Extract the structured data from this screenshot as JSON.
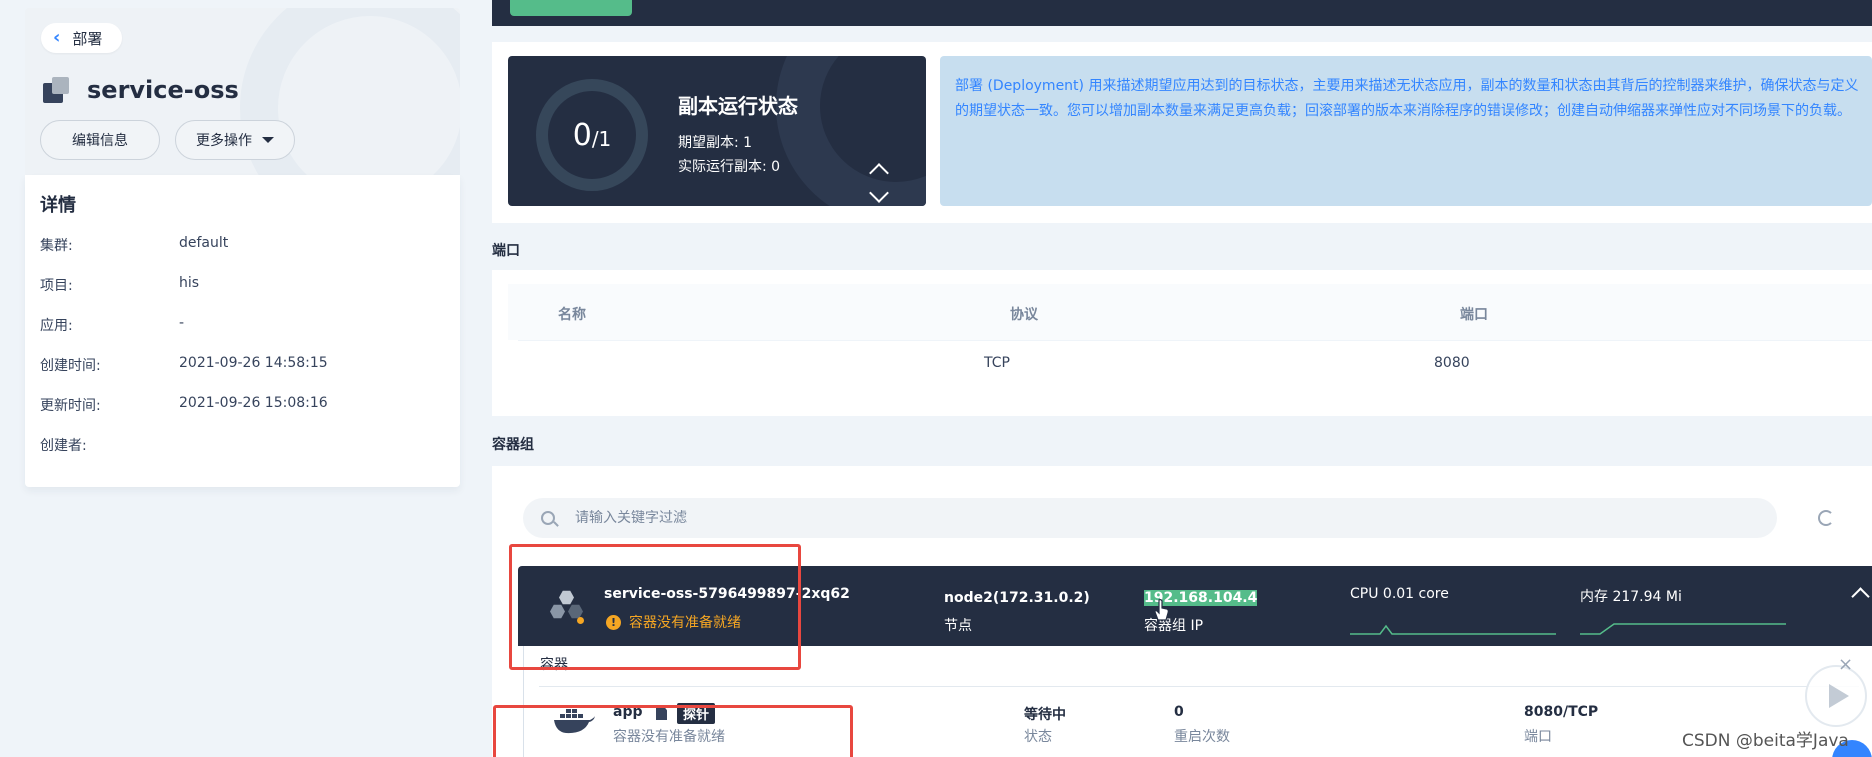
{
  "left": {
    "back_label": "部署",
    "service_name": "service-oss",
    "edit_button": "编辑信息",
    "more_button": "更多操作",
    "details_title": "详情",
    "details": [
      {
        "key": "集群:",
        "value": "default"
      },
      {
        "key": "项目:",
        "value": "his"
      },
      {
        "key": "应用:",
        "value": "-"
      },
      {
        "key": "创建时间:",
        "value": "2021-09-26 14:58:15"
      },
      {
        "key": "更新时间:",
        "value": "2021-09-26 15:08:16"
      },
      {
        "key": "创建者:",
        "value": ""
      }
    ]
  },
  "replica_status": {
    "current": "0",
    "total": "/1",
    "title": "副本运行状态",
    "desired": "期望副本: 1",
    "actual": "实际运行副本: 0"
  },
  "info_text": "部署 (Deployment) 用来描述期望应用达到的目标状态，主要用来描述无状态应用，副本的数量和状态由其背后的控制器来维护，确保状态与定义的期望状态一致。您可以增加副本数量来满足更高负载；回滚部署的版本来消除程序的错误修改；创建自动伸缩器来弹性应对不同场景下的负载。",
  "ports": {
    "section_title": "端口",
    "headers": [
      "名称",
      "协议",
      "端口"
    ],
    "row": {
      "name": "",
      "protocol": "TCP",
      "port": "8080"
    }
  },
  "pods": {
    "section_title": "容器组",
    "search_placeholder": "请输入关键字过滤",
    "pod": {
      "name": "service-oss-5796499897-2xq62",
      "status": "容器没有准备就绪",
      "node": "node2(172.31.0.2)",
      "node_label": "节点",
      "ip": "192.168.104.4",
      "ip_label": "容器组 IP",
      "cpu": "CPU 0.01 core",
      "memory": "内存 217.94 Mi"
    },
    "containers_title": "容器",
    "container": {
      "name": "app",
      "probe": "探针",
      "status_text": "容器没有准备就绪",
      "state": "等待中",
      "state_label": "状态",
      "restarts": "0",
      "restarts_label": "重启次数",
      "port": "8080/TCP",
      "port_label": "端口"
    }
  },
  "watermark": "CSDN @beita学Java",
  "colors": {
    "dark": "#242e42",
    "green": "#55bc8a",
    "warning": "#f5a623",
    "info_bg": "#c7deef",
    "info_text": "#3385ff",
    "annotation": "#e8473f"
  }
}
